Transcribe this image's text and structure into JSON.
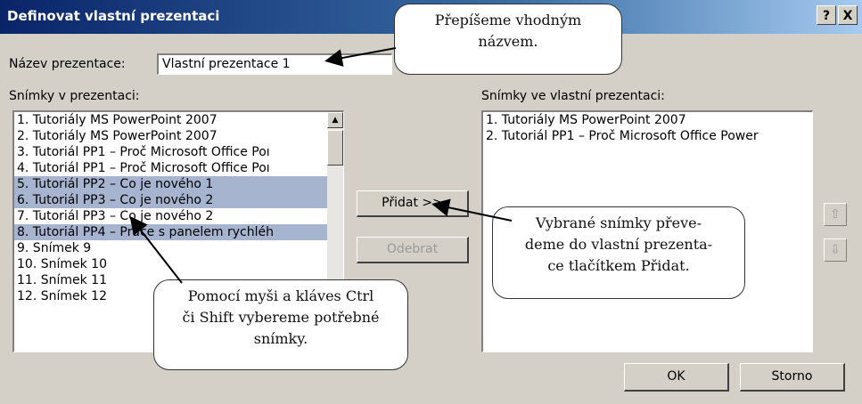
{
  "dialog": {
    "title": "Definovat vlastní prezentaci",
    "help_label": "?",
    "close_label": "X"
  },
  "name_field": {
    "label": "Název prezentace:",
    "value": "Vlastní prezentace 1"
  },
  "left_list": {
    "label": "Snímky v prezentaci:",
    "items": [
      {
        "text": "1. Tutoriály MS PowerPoint 2007",
        "selected": false
      },
      {
        "text": "2. Tutoriály MS PowerPoint 2007",
        "selected": false
      },
      {
        "text": "3. Tutoriál PP1 – Proč Microsoft Office Poı",
        "selected": false
      },
      {
        "text": "4. Tutoriál PP1 – Proč Microsoft Office Poı",
        "selected": false
      },
      {
        "text": "5. Tutoriál PP2 – Co je nového 1",
        "selected": true
      },
      {
        "text": "6. Tutoriál PP3 – Co je nového 2",
        "selected": true
      },
      {
        "text": "7. Tutoriál PP3 – Co je nového 2",
        "selected": false
      },
      {
        "text": "8. Tutoriál PP4 – Práce s panelem rychléh",
        "selected": true
      },
      {
        "text": "9. Snímek 9",
        "selected": false
      },
      {
        "text": "10. Snímek 10",
        "selected": false
      },
      {
        "text": "11. Snímek 11",
        "selected": false
      },
      {
        "text": "12. Snímek 12",
        "selected": false
      }
    ]
  },
  "right_list": {
    "label": "Snímky ve vlastní prezentaci:",
    "items": [
      "1. Tutoriály MS PowerPoint 2007",
      "2. Tutoriál PP1 – Proč Microsoft Office Power"
    ]
  },
  "buttons": {
    "add": "Přidat >>",
    "remove": "Odebrat",
    "ok": "OK",
    "cancel": "Storno"
  },
  "callouts": {
    "rename": [
      "Přepíšeme vhodným",
      "názvem."
    ],
    "add": [
      "Vybrané snímky převe-",
      "deme do vlastní prezenta-",
      "ce tlačítkem Přidat."
    ],
    "select": [
      "Pomocí myši a kláves Ctrl",
      "či Shift vybereme potřebné",
      "snímky."
    ]
  },
  "colors": {
    "titlebar_start": "#0a246a",
    "titlebar_end": "#a6caf0",
    "selection": "#a7b4cf",
    "dialog_bg": "#d4d0c8"
  }
}
